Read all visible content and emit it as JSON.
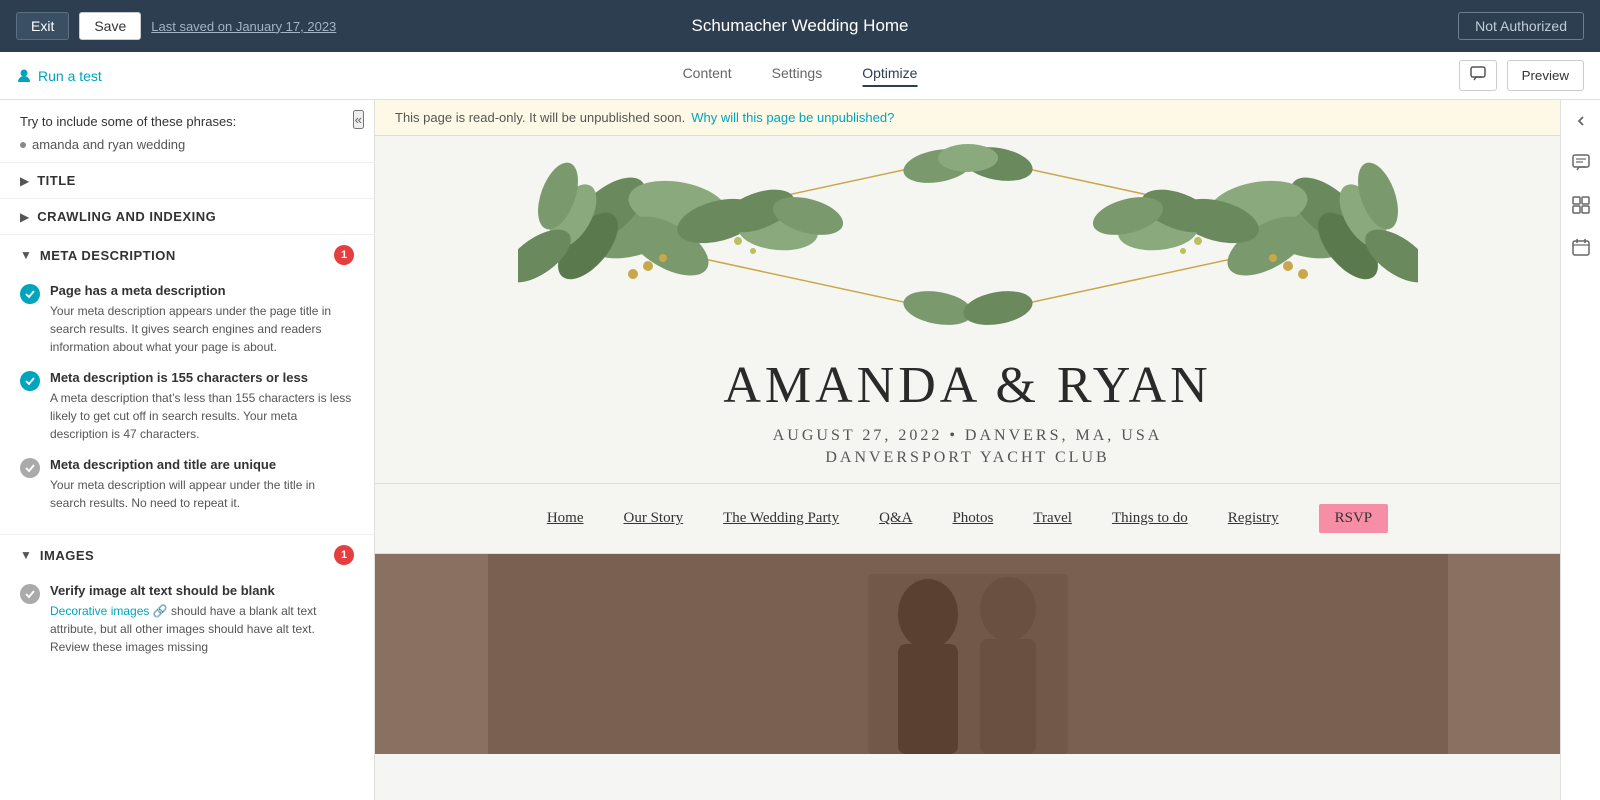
{
  "topbar": {
    "exit_label": "Exit",
    "save_label": "Save",
    "last_saved": "Last saved on January 17, 2023",
    "page_title": "Schumacher Wedding Home",
    "not_authorized_label": "Not Authorized"
  },
  "subnav": {
    "run_test_label": "Run a test",
    "tabs": [
      {
        "id": "content",
        "label": "Content",
        "active": false
      },
      {
        "id": "settings",
        "label": "Settings",
        "active": false
      },
      {
        "id": "optimize",
        "label": "Optimize",
        "active": true
      }
    ],
    "preview_label": "Preview"
  },
  "sidebar": {
    "phrases_title": "Try to include some of these phrases:",
    "phrase_item": "amanda and ryan wedding",
    "sections": [
      {
        "id": "title",
        "label": "TITLE",
        "expanded": false,
        "badge": null
      },
      {
        "id": "crawling",
        "label": "CRAWLING AND INDEXING",
        "expanded": false,
        "badge": null
      },
      {
        "id": "meta_description",
        "label": "META DESCRIPTION",
        "expanded": true,
        "badge": 1,
        "checks": [
          {
            "id": "has_meta",
            "status": "green",
            "title": "Page has a meta description",
            "desc": "Your meta description appears under the page title in search results. It gives search engines and readers information about what your page is about."
          },
          {
            "id": "meta_length",
            "status": "green",
            "title": "Meta description is 155 characters or less",
            "desc": "A meta description that’s less than 155 characters is less likely to get cut off in search results. Your meta description is 47 characters."
          },
          {
            "id": "meta_unique",
            "status": "gray",
            "title": "Meta description and title are unique",
            "desc": "Your meta description will appear under the title in search results. No need to repeat it."
          }
        ]
      },
      {
        "id": "images",
        "label": "IMAGES",
        "expanded": true,
        "badge": 1,
        "checks": [
          {
            "id": "alt_text",
            "status": "gray",
            "title": "Verify image alt text should be blank",
            "desc": "should have a blank alt text attribute, but all other images should have alt text. Review these images missing",
            "link_text": "Decorative images"
          }
        ]
      }
    ]
  },
  "banner": {
    "text": "This page is read-only. It will be unpublished soon.",
    "link_text": "Why will this page be unpublished?"
  },
  "wedding": {
    "couple": "AMANDA & RYAN",
    "date": "AUGUST 27, 2022 • DANVERS, MA, USA",
    "venue": "DANVERSPORT YACHT CLUB",
    "nav_items": [
      {
        "label": "Home",
        "rsvp": false
      },
      {
        "label": "Our Story",
        "rsvp": false
      },
      {
        "label": "The Wedding Party",
        "rsvp": false
      },
      {
        "label": "Q&A",
        "rsvp": false
      },
      {
        "label": "Photos",
        "rsvp": false
      },
      {
        "label": "Travel",
        "rsvp": false
      },
      {
        "label": "Things to do",
        "rsvp": false
      },
      {
        "label": "Registry",
        "rsvp": false
      },
      {
        "label": "RSVP",
        "rsvp": true
      }
    ]
  },
  "colors": {
    "accent": "#00a4bd",
    "topbar_bg": "#2d3e50",
    "badge_red": "#e53e3e",
    "rsvp_pink": "#f78da7"
  }
}
